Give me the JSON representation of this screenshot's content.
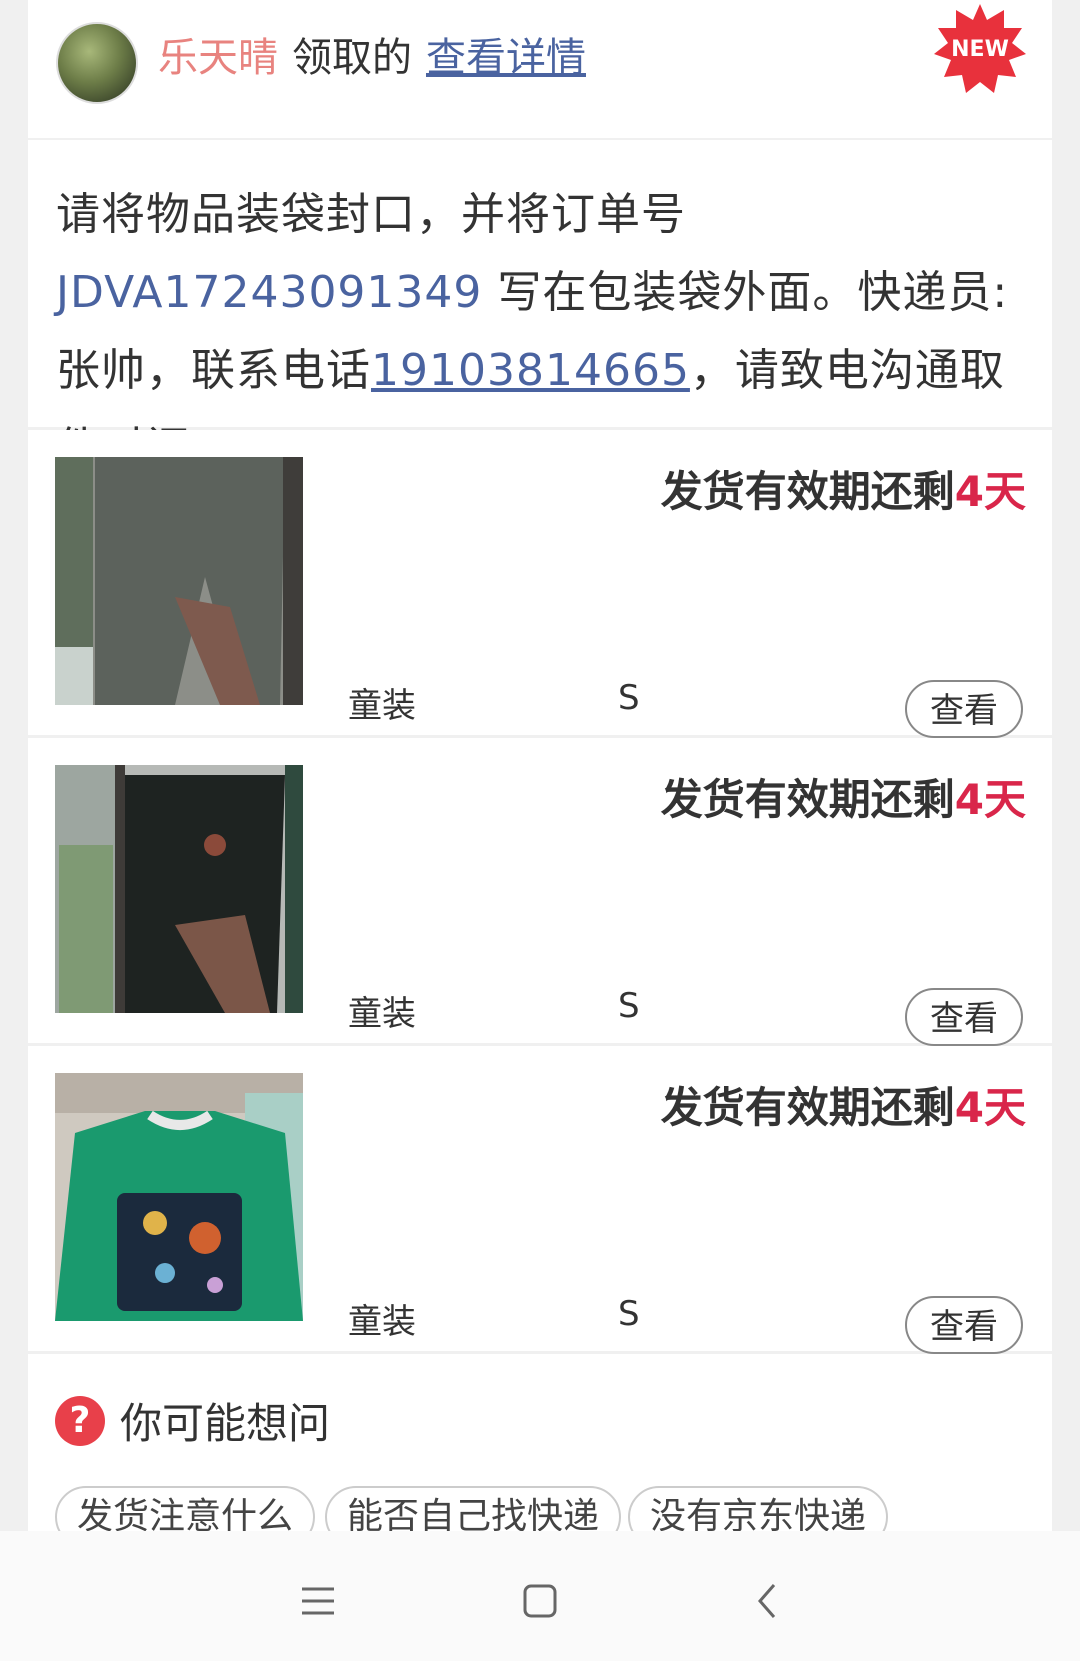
{
  "header": {
    "user_name": "乐天晴",
    "claim_text": "领取的",
    "detail_link": "查看详情",
    "badge": "NEW"
  },
  "notice": {
    "part1": "请将物品装袋封口，并将订单号 ",
    "order_no": "JDVA17243091349",
    "part2": " 写在包装袋外面。快递员:张帅，联系电话",
    "phone": "19103814665",
    "part3": "，请致电沟通取件时间。"
  },
  "items": [
    {
      "deadline_prefix": "发货有效期还剩",
      "days": "4天",
      "category": "童装",
      "size": "S",
      "view_label": "查看",
      "photo": "gray pants"
    },
    {
      "deadline_prefix": "发货有效期还剩",
      "days": "4天",
      "category": "童装",
      "size": "S",
      "view_label": "查看",
      "photo": "black pants"
    },
    {
      "deadline_prefix": "发货有效期还剩",
      "days": "4天",
      "category": "童装",
      "size": "S",
      "view_label": "查看",
      "photo": "green sweatshirt"
    }
  ],
  "faq": {
    "icon": "question-icon",
    "title": "你可能想问",
    "chips": [
      "发货注意什么",
      "能否自己找快递",
      "没有京东快递"
    ]
  },
  "navbar": {
    "icons": [
      "menu-icon",
      "home-icon",
      "back-icon"
    ]
  }
}
